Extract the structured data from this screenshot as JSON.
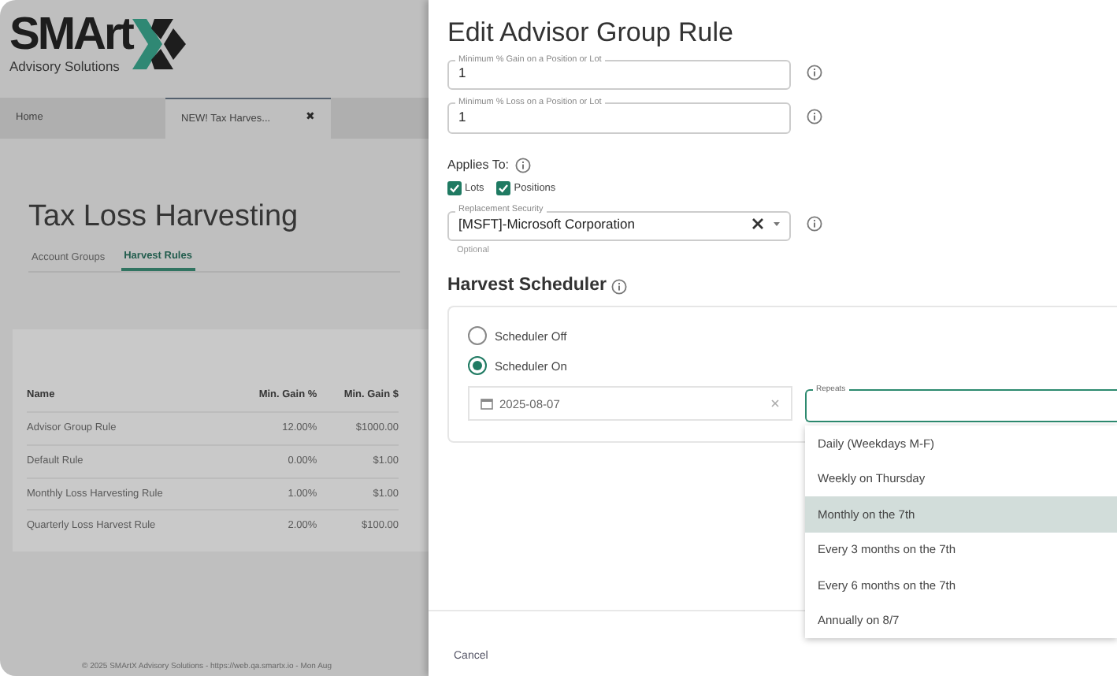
{
  "logo": {
    "name": "SMArt",
    "tagline": "Advisory Solutions"
  },
  "tabs": [
    {
      "label": "Home",
      "selected": false
    },
    {
      "label": "NEW! Tax Harves...",
      "selected": true,
      "close": "✖"
    }
  ],
  "page": {
    "title": "Tax Loss Harvesting",
    "subtabs": [
      {
        "label": "Account Groups",
        "selected": false
      },
      {
        "label": "Harvest Rules",
        "selected": true
      }
    ],
    "table": {
      "columns": [
        "Name",
        "Min. Gain %",
        "Min. Gain $"
      ],
      "rows": [
        [
          "Advisor Group Rule",
          "12.00%",
          "$1000.00"
        ],
        [
          "Default Rule",
          "0.00%",
          "$1.00"
        ],
        [
          "Monthly Loss Harvesting Rule",
          "1.00%",
          "$1.00"
        ],
        [
          "Quarterly Loss Harvest Rule",
          "2.00%",
          "$100.00"
        ]
      ]
    }
  },
  "footer": "© 2025 SMArtX Advisory Solutions - https://web.qa.smartx.io - Mon Aug",
  "dialog": {
    "title": "Edit Advisor Group Rule",
    "fields": [
      {
        "label": "Minimum % Gain on a Position or Lot",
        "value": "1"
      },
      {
        "label": "Minimum % Loss on a Position or Lot",
        "value": "1"
      }
    ],
    "applies_to": {
      "label": "Applies To:",
      "options": [
        {
          "label": "Lots",
          "checked": true
        },
        {
          "label": "Positions",
          "checked": true
        }
      ]
    },
    "replacement_security": {
      "label": "Replacement Security",
      "value": "[MSFT]-Microsoft Corporation",
      "hint": "Optional"
    },
    "scheduler": {
      "title": "Harvest Scheduler",
      "modes": [
        {
          "label": "Scheduler Off",
          "selected": false
        },
        {
          "label": "Scheduler On",
          "selected": true
        }
      ],
      "start_date": "2025-08-07",
      "repeats": {
        "label": "Repeats",
        "options": [
          {
            "label": "Daily (Weekdays M-F)",
            "selected": false
          },
          {
            "label": "Weekly on Thursday",
            "selected": false
          },
          {
            "label": "Monthly on the 7th",
            "selected": true
          },
          {
            "label": "Every 3 months on the 7th",
            "selected": false
          },
          {
            "label": "Every 6 months on the 7th",
            "selected": false
          },
          {
            "label": "Annually on 8/7",
            "selected": false
          }
        ]
      }
    },
    "cancel": "Cancel"
  }
}
